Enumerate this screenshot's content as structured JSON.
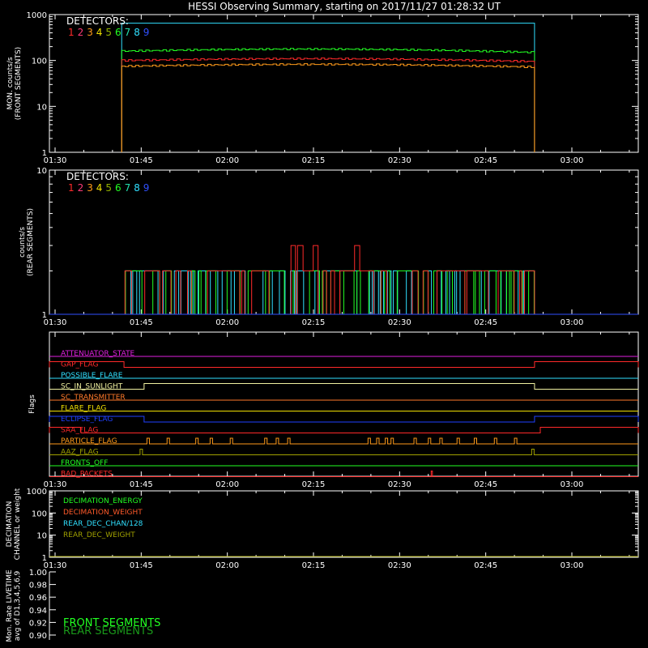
{
  "title": "HESSI Observing Summary, starting on 2017/11/27 01:28:32 UT",
  "time_ticks": [
    "01:30",
    "01:45",
    "02:00",
    "02:15",
    "02:30",
    "02:45",
    "03:00"
  ],
  "detector_legend": {
    "label": "DETECTORS:",
    "items": [
      {
        "n": "1",
        "color": "#ff2a2a"
      },
      {
        "n": "2",
        "color": "#ff3a7a"
      },
      {
        "n": "3",
        "color": "#ff9a1a"
      },
      {
        "n": "4",
        "color": "#f0e000"
      },
      {
        "n": "5",
        "color": "#90b000"
      },
      {
        "n": "6",
        "color": "#22ff22"
      },
      {
        "n": "7",
        "color": "#22e0b0"
      },
      {
        "n": "8",
        "color": "#30e0ff"
      },
      {
        "n": "9",
        "color": "#3050ff"
      }
    ]
  },
  "chart_data": [
    {
      "type": "line",
      "id": "front",
      "ylabel": "MON. counts/s (FRONT SEGMENTS)",
      "yscale": "log",
      "ylim": [
        1,
        1000
      ],
      "y_ticks": [
        "1",
        "10",
        "100",
        "1000"
      ],
      "xlim_minutes": [
        1.47,
        28.8
      ],
      "series": [
        {
          "detector": "8",
          "color": "#30e0ff",
          "level_start": 650,
          "level_end": 650,
          "on": "01:41.6",
          "off": "02:53.5"
        },
        {
          "detector": "6",
          "color": "#22ff22",
          "level_start": 160,
          "level_end": 150,
          "on": "01:41.6",
          "off": "02:53.5"
        },
        {
          "detector": "1",
          "color": "#ff2a2a",
          "level_start": 100,
          "level_end": 95,
          "on": "01:41.6",
          "off": "02:53.5"
        },
        {
          "detector": "3",
          "color": "#ff9a1a",
          "level_start": 75,
          "level_end": 72,
          "on": "01:41.6",
          "off": "02:53.5"
        }
      ]
    },
    {
      "type": "line",
      "id": "rear",
      "ylabel": "counts/s (REAR SEGMENTS)",
      "yscale": "log",
      "ylim": [
        1,
        10
      ],
      "y_ticks": [
        "1",
        "10"
      ],
      "series": [
        {
          "detector": "8",
          "color": "#30e0ff",
          "levels": [
            1,
            2
          ]
        },
        {
          "detector": "6",
          "color": "#22ff22",
          "levels": [
            1,
            2
          ]
        },
        {
          "detector": "1",
          "color": "#ff2a2a",
          "levels": [
            1,
            2,
            3
          ]
        }
      ]
    },
    {
      "type": "flags",
      "id": "flags",
      "ylabel": "Flags",
      "rows": [
        {
          "label": "ATTENUATOR_STATE",
          "color": "#e020e0",
          "segments": []
        },
        {
          "label": "GAP_FLAG",
          "color": "#ff2a2a",
          "segments": [
            [
              "01:30",
              "01:42.0"
            ],
            [
              "02:53.5",
              "03:08"
            ]
          ]
        },
        {
          "label": "POSSIBLE_FLARE",
          "color": "#30e0ff",
          "segments": []
        },
        {
          "label": "SC_IN_SUNLIGHT",
          "color": "#f0f0a0",
          "segments": [
            [
              "01:45.5",
              "02:53.5"
            ]
          ]
        },
        {
          "label": "SC_TRANSMITTER",
          "color": "#ff7a2a",
          "segments": []
        },
        {
          "label": "FLARE_FLAG",
          "color": "#f0e000",
          "segments": []
        },
        {
          "label": "ECLIPSE_FLAG",
          "color": "#2040ff",
          "segments": [
            [
              "01:30",
              "01:45.5"
            ],
            [
              "02:53.5",
              "03:08"
            ]
          ]
        },
        {
          "label": "SAA_FLAG",
          "color": "#ff2a2a",
          "segments": [
            [
              "01:30",
              "01:34.5"
            ],
            [
              "02:54.5",
              "03:08"
            ]
          ]
        },
        {
          "label": "PARTICLE_FLAG",
          "color": "#ff9a1a",
          "pulses": [
            "01:46.0",
            "01:49.5",
            "01:54.5",
            "01:57.0",
            "02:00.5",
            "02:06.5",
            "02:08.5",
            "02:10.5",
            "02:24.5",
            "02:26.0",
            "02:27.5",
            "02:28.5",
            "02:32.5",
            "02:35.0",
            "02:37.0",
            "02:40.0",
            "02:43.0",
            "02:46.5",
            "02:50.0"
          ]
        },
        {
          "label": "AAZ_FLAG",
          "color": "#a0a000",
          "pulses": [
            "01:44.8",
            "02:53.0"
          ]
        },
        {
          "label": "FRONTS_OFF",
          "color": "#22ff22",
          "segments": []
        },
        {
          "label": "BAD_PACKETS",
          "color": "#ff2a2a",
          "pulses": [
            "02:35.5"
          ]
        }
      ]
    },
    {
      "type": "line",
      "id": "decimation",
      "ylabel": "DECIMATION CHANNEL or weight",
      "yscale": "log",
      "ylim": [
        1,
        1000
      ],
      "y_ticks": [
        "1",
        "10",
        "100",
        "1000"
      ],
      "legend": [
        {
          "label": "DECIMATION_ENERGY",
          "color": "#22ff22"
        },
        {
          "label": "DECIMATION_WEIGHT",
          "color": "#ff5a2a"
        },
        {
          "label": "REAR_DEC_CHAN/128",
          "color": "#30e0ff"
        },
        {
          "label": "REAR_DEC_WEIGHT",
          "color": "#a0a000"
        }
      ]
    },
    {
      "type": "line",
      "id": "livetime",
      "ylabel": "Mon. Rate LIVETIME avg of D1,3,4,5,6,9",
      "ylim": [
        0.9,
        1.0
      ],
      "y_ticks": [
        "1.00",
        "0.98",
        "0.96",
        "0.94",
        "0.92",
        "0.90"
      ],
      "legend": [
        {
          "label": "FRONT SEGMENTS",
          "color": "#22ff22"
        },
        {
          "label": "REAR SEGMENTS",
          "color": "#1a9a1a"
        }
      ]
    }
  ]
}
